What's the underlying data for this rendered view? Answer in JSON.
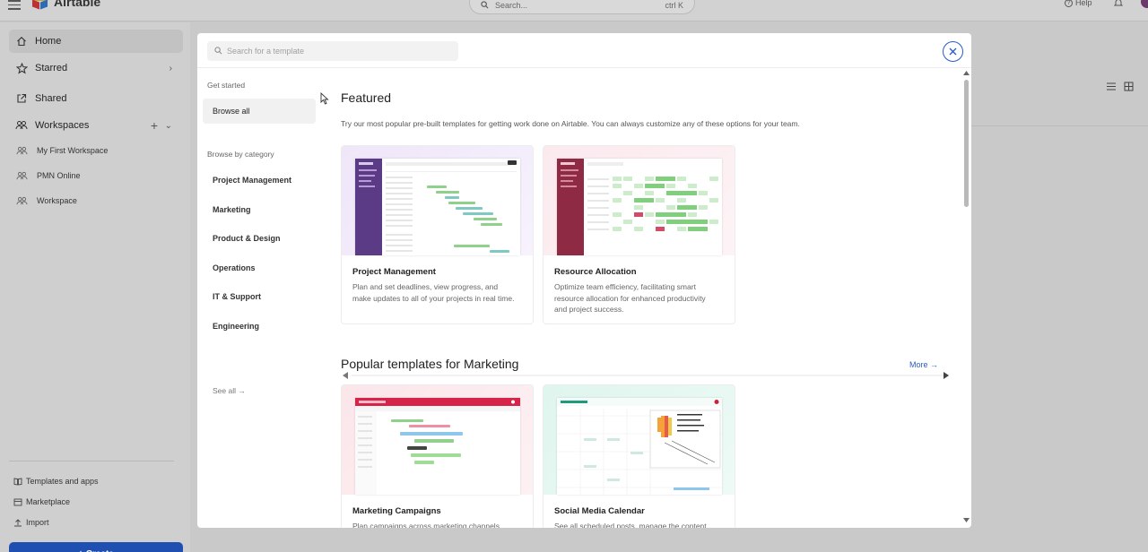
{
  "app": {
    "name": "Airtable",
    "search_placeholder": "Search...",
    "search_shortcut": "ctrl K",
    "help_label": "Help"
  },
  "sidebar": {
    "home": "Home",
    "starred": "Starred",
    "shared": "Shared",
    "workspaces": "Workspaces",
    "workspace_items": [
      "My First Workspace",
      "PMN Online",
      "Workspace"
    ],
    "templates_and_apps": "Templates and apps",
    "marketplace": "Marketplace",
    "import": "Import",
    "create": "+ Create"
  },
  "modal": {
    "search_placeholder": "Search for a template",
    "nav": {
      "get_started": "Get started",
      "browse_all": "Browse all",
      "browse_by_category": "Browse by category",
      "categories": [
        "Project Management",
        "Marketing",
        "Product & Design",
        "Operations",
        "IT & Support",
        "Engineering"
      ],
      "see_all": "See all →"
    },
    "featured": {
      "title": "Featured",
      "description": "Try our most popular pre-built templates for getting work done on Airtable. You can always customize any of these options for your team.",
      "cards": [
        {
          "title": "Project Management",
          "description": "Plan and set deadlines, view progress, and make updates to all of your projects in real time."
        },
        {
          "title": "Resource Allocation",
          "description": "Optimize team efficiency, facilitating smart resource allocation for enhanced productivity and project success."
        }
      ]
    },
    "marketing": {
      "title": "Popular templates for Marketing",
      "more": "More →",
      "cards": [
        {
          "title": "Marketing Campaigns",
          "description": "Plan campaigns across marketing channels"
        },
        {
          "title": "Social Media Calendar",
          "description": "See all scheduled posts, manage the content"
        }
      ]
    }
  },
  "colors": {
    "accent": "#2a5bc5",
    "create_button": "#1f4fb0",
    "pm_sidebar": "#5b3a86",
    "ra_sidebar": "#8e2a43",
    "gantt_green": "#8fd18a",
    "gantt_teal": "#7fc9c3",
    "mc_header": "#d6234a",
    "sm_header": "#1f9a7b"
  }
}
